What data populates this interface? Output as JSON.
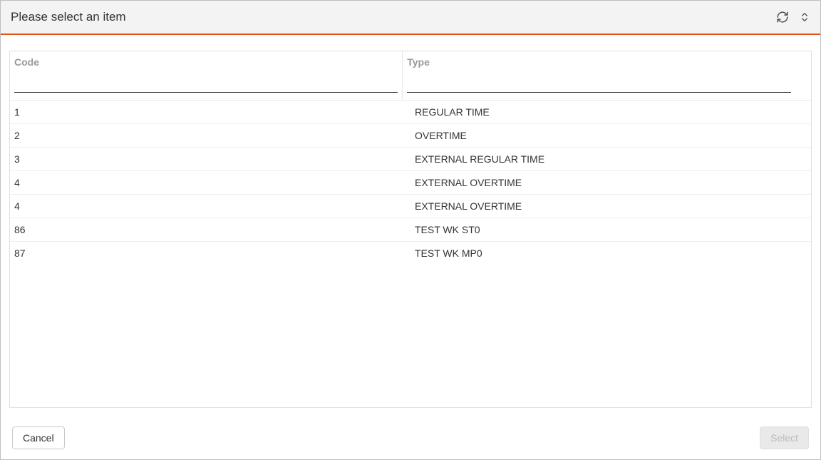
{
  "header": {
    "title": "Please select an item"
  },
  "columns": {
    "code": "Code",
    "type": "Type"
  },
  "filters": {
    "code": "",
    "type": ""
  },
  "rows": [
    {
      "code": "1",
      "type": "REGULAR TIME"
    },
    {
      "code": "2",
      "type": "OVERTIME"
    },
    {
      "code": "3",
      "type": "EXTERNAL REGULAR TIME"
    },
    {
      "code": "4",
      "type": "EXTERNAL OVERTIME"
    },
    {
      "code": "4",
      "type": "EXTERNAL OVERTIME"
    },
    {
      "code": "86",
      "type": "TEST WK ST0"
    },
    {
      "code": "87",
      "type": "TEST WK MP0"
    }
  ],
  "footer": {
    "cancel": "Cancel",
    "select": "Select"
  }
}
